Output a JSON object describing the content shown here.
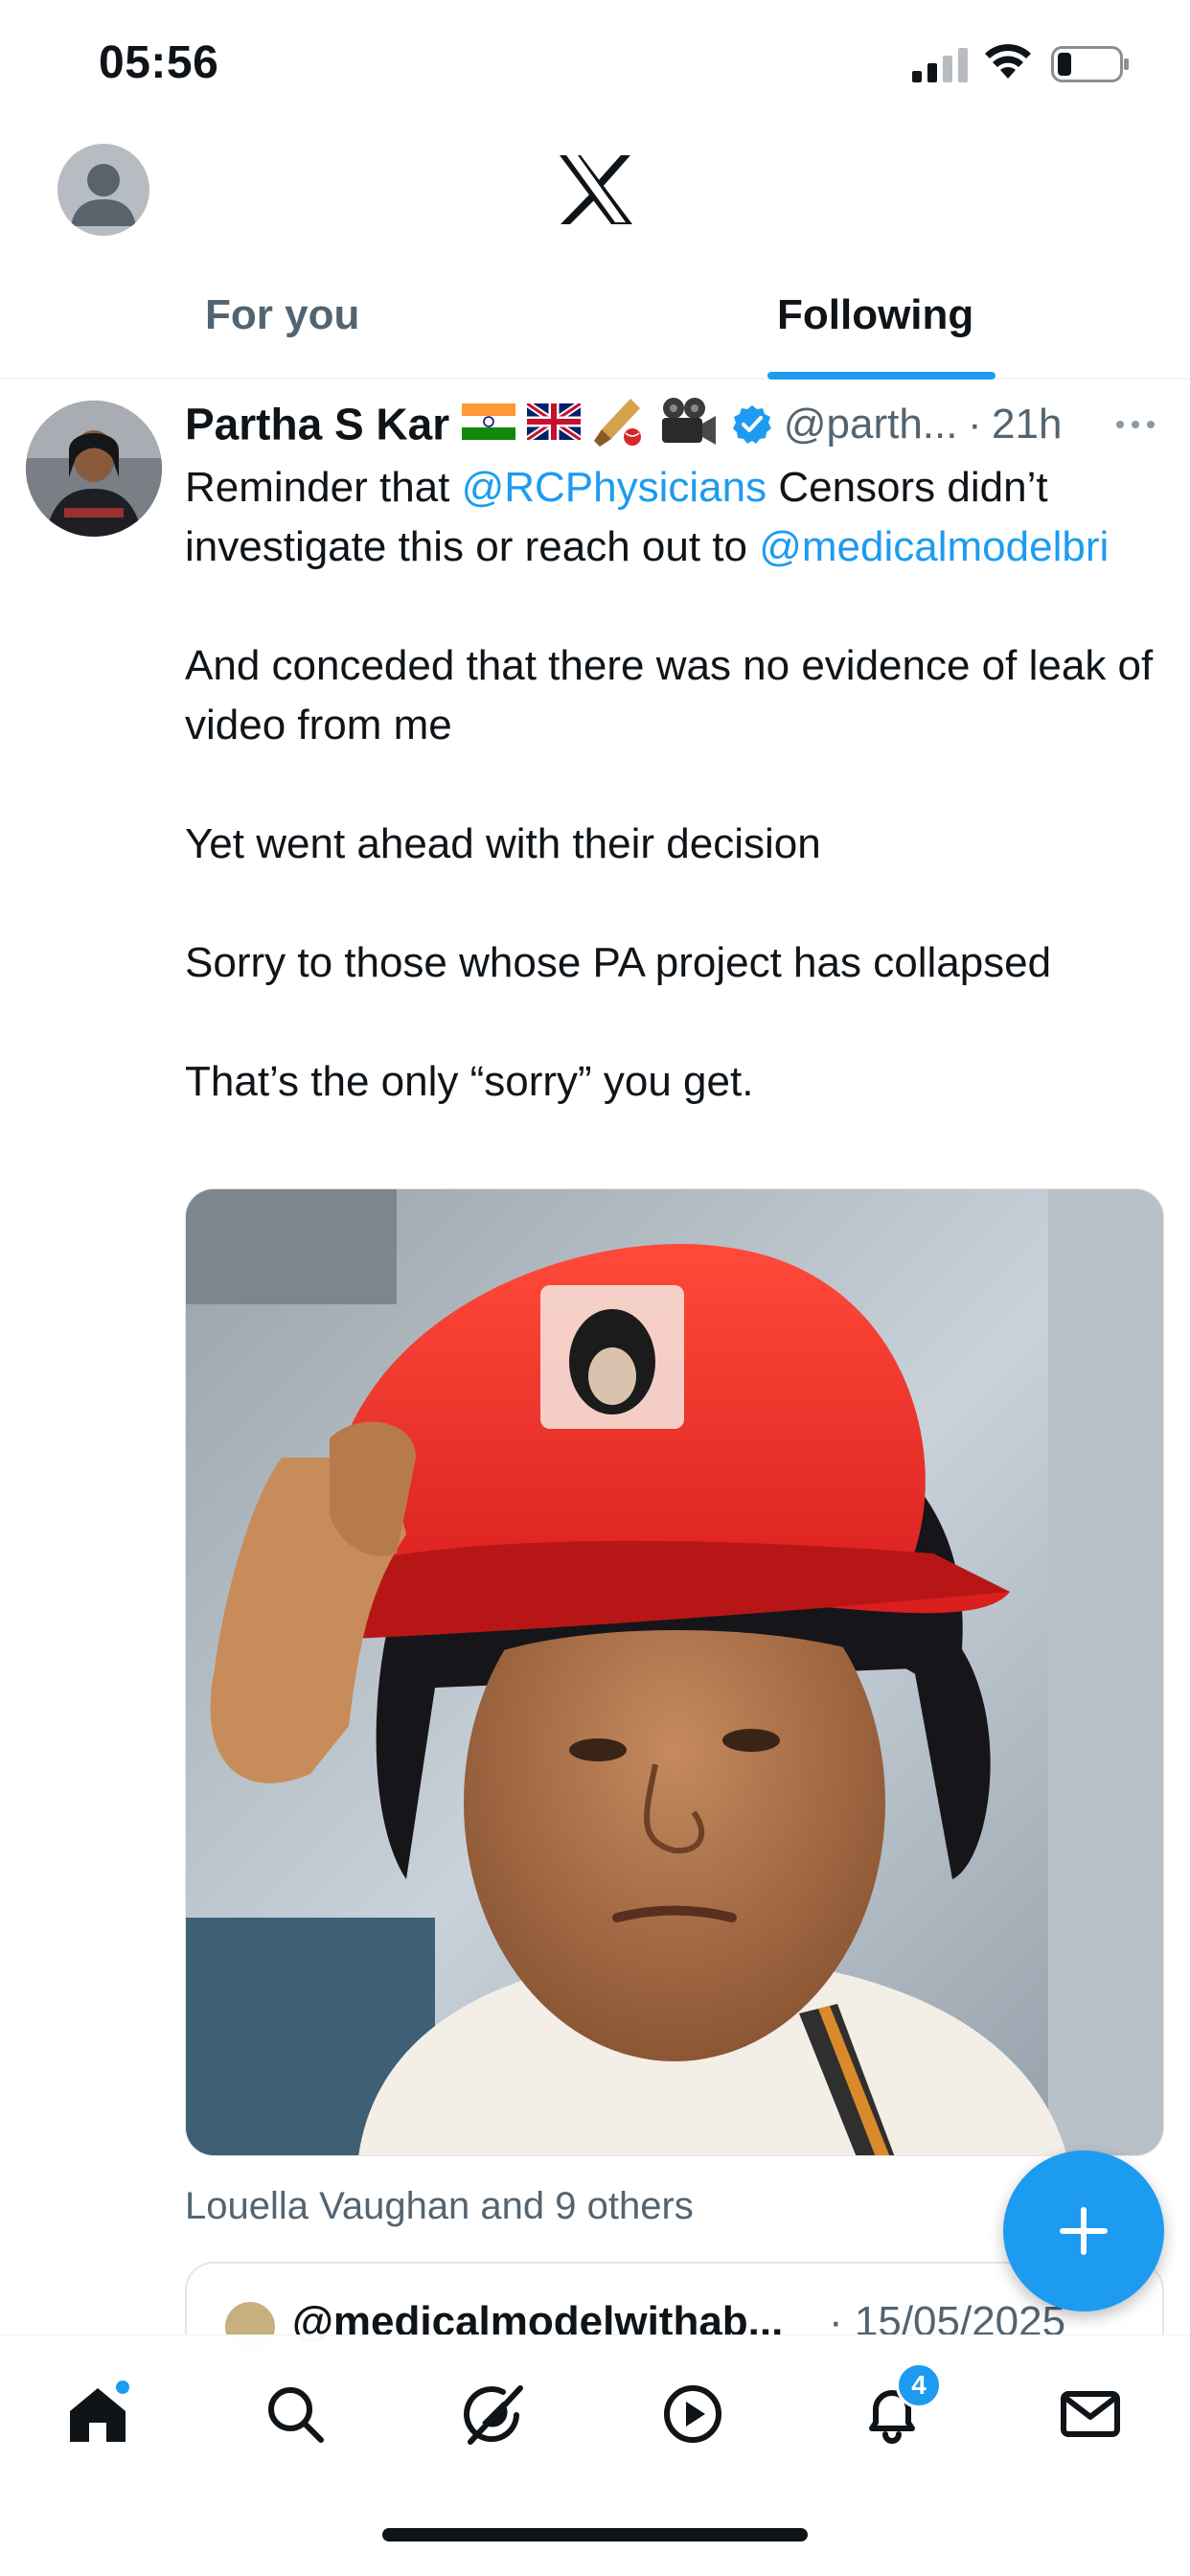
{
  "status_bar": {
    "time": "05:56"
  },
  "header": {
    "logo": "x-logo-icon"
  },
  "tabs": [
    {
      "label": "For you",
      "active": false
    },
    {
      "label": "Following",
      "active": true
    }
  ],
  "tweet": {
    "author_name": "Partha S Kar",
    "author_emojis": [
      "🇮🇳",
      "🇬🇧",
      "🏏",
      "🎥"
    ],
    "handle": "@parth...",
    "time_ago": "21h",
    "text": {
      "p1_pre": "Reminder that ",
      "p1_mention1": "@RCPhysicians",
      "p1_mid": " Censors didn’t investigate this or reach out to ",
      "p1_mention2": "@medicalmodelbri",
      "p2": "And conceded that there was no evidence of leak of video from me",
      "p3": "Yet went ahead with their decision",
      "p4": "Sorry to those whose PA project has collapsed",
      "p5": "That’s the only “sorry” you get."
    },
    "liked_by": "Louella Vaughan and 9 others",
    "quote": {
      "handle": "@medicalmodelwithab...",
      "date": "· 15/05/2025"
    }
  },
  "bottom_nav": {
    "items": [
      "home-icon",
      "search-icon",
      "grok-icon",
      "video-icon",
      "notifications-icon",
      "messages-icon"
    ],
    "notifications_count": "4"
  },
  "colors": {
    "accent": "#1d9bf0",
    "text_primary": "#0f1419",
    "text_secondary": "#536471"
  }
}
